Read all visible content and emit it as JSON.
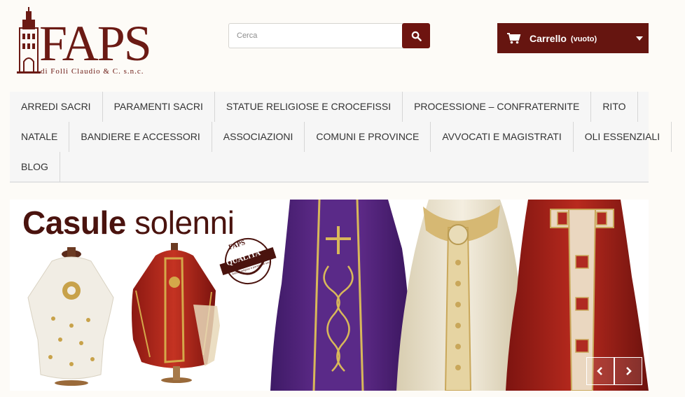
{
  "logo": {
    "brand": "FAPS",
    "subtitle": "di Folli Claudio & C. s.n.c."
  },
  "search": {
    "placeholder": "Cerca"
  },
  "cart": {
    "label": "Carrello",
    "status": "(vuoto)"
  },
  "menu": {
    "row1": [
      "ARREDI SACRI",
      "PARAMENTI SACRI",
      "STATUE RELIGIOSE E CROCEFISSI",
      "PROCESSIONE – CONFRATERNITE",
      "RITO"
    ],
    "row2": [
      "NATALE",
      "BANDIERE E ACCESSORI",
      "ASSOCIAZIONI",
      "COMUNI E PROVINCE",
      "AVVOCATI E MAGISTRATI",
      "OLI ESSENZIALI"
    ],
    "row3": [
      "BLOG"
    ]
  },
  "banner": {
    "title_bold": "Casule",
    "title_regular": "solenni",
    "badge_top": "FAPS",
    "badge_main": "QUALITA'",
    "badge_sub": "Articoli religiosi e paramenti sacri"
  },
  "colors": {
    "brand": "#6e1410",
    "cart_bg": "#661510",
    "menu_bg": "#f6f6f6"
  },
  "icons": {
    "search": "search-icon",
    "cart": "cart-icon",
    "prev": "chevron-left-icon",
    "next": "chevron-right-icon"
  }
}
